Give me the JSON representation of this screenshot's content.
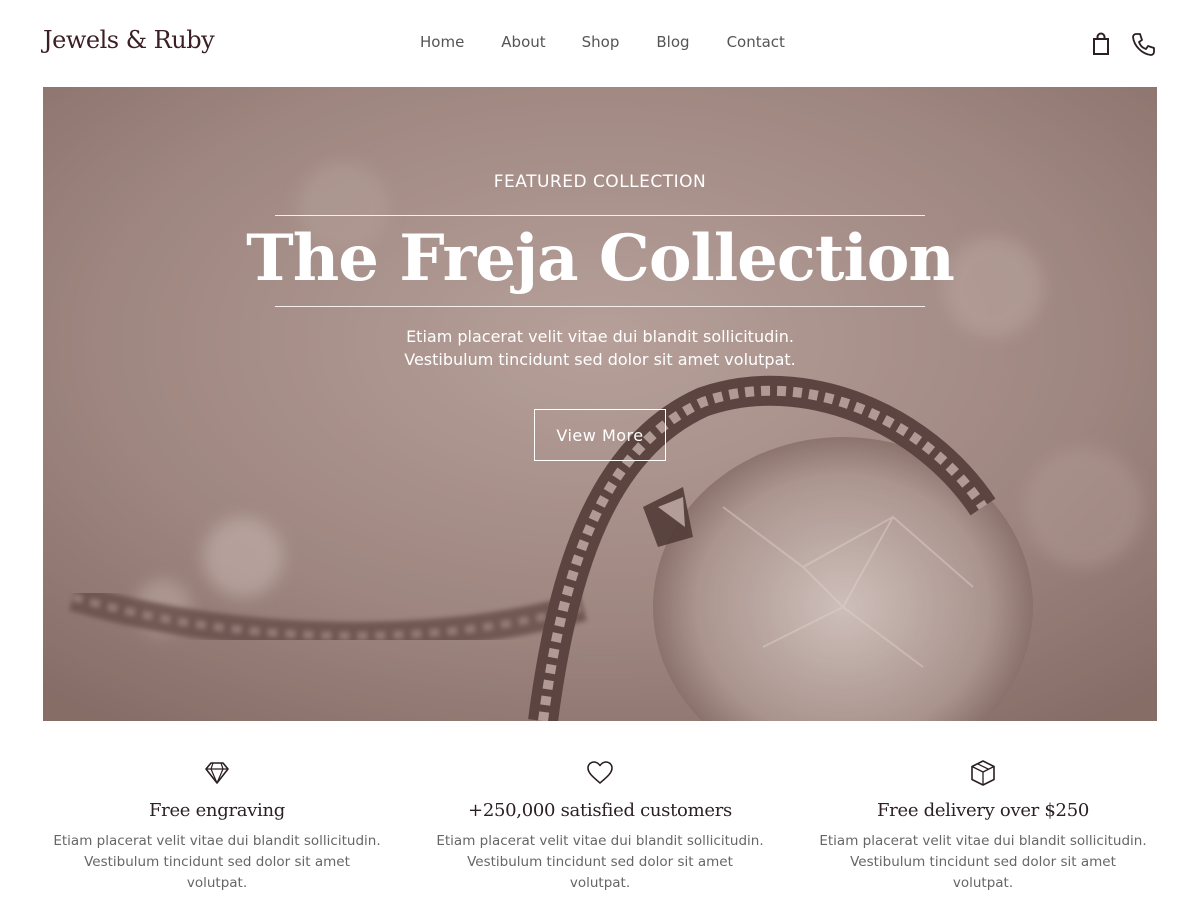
{
  "header": {
    "logo": "Jewels & Ruby",
    "nav": [
      "Home",
      "About",
      "Shop",
      "Blog",
      "Contact"
    ],
    "icons": [
      "shopping-bag-icon",
      "phone-icon"
    ]
  },
  "hero": {
    "eyebrow": "FEATURED COLLECTION",
    "title": "The Freja Collection",
    "text": "Etiam placerat velit vitae dui blandit sollicitudin. Vestibulum tincidunt sed dolor sit amet volutpat.",
    "button": "View More"
  },
  "features": [
    {
      "icon": "diamond-icon",
      "title": "Free engraving",
      "text": "Etiam placerat velit vitae dui blandit sollicitudin. Vestibulum tincidunt sed dolor sit amet volutpat."
    },
    {
      "icon": "heart-icon",
      "title": "+250,000 satisfied customers",
      "text": "Etiam placerat velit vitae dui blandit sollicitudin. Vestibulum tincidunt sed dolor sit amet volutpat."
    },
    {
      "icon": "box-icon",
      "title": "Free delivery over $250",
      "text": "Etiam placerat velit vitae dui blandit sollicitudin. Vestibulum tincidunt sed dolor sit amet volutpat."
    }
  ],
  "colors": {
    "brand": "#3a1f26",
    "hero_tint": "#a08a84"
  }
}
